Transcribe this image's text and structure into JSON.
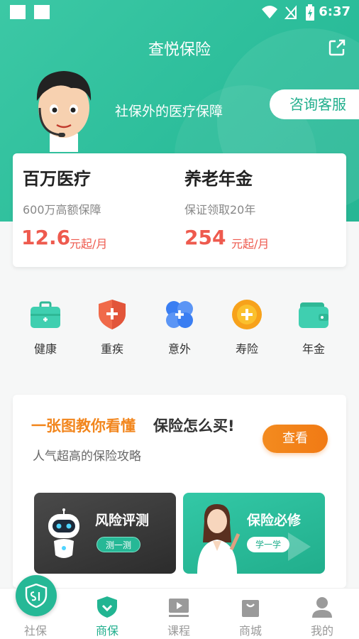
{
  "status_bar": {
    "time": "6:37"
  },
  "header": {
    "title": "查悦保险",
    "slogan": "社保外的医疗保障",
    "service_button": "咨询客服"
  },
  "products": [
    {
      "name": "百万医疗",
      "subtitle": "600万高额保障",
      "price": "12.6",
      "unit": "元起/月"
    },
    {
      "name": "养老年金",
      "subtitle": "保证领取20年",
      "price": "254",
      "unit": "元起/月"
    }
  ],
  "categories": [
    {
      "label": "健康",
      "icon": "medical-kit-icon",
      "color": "#3fcfb0"
    },
    {
      "label": "重疾",
      "icon": "shield-plus-icon",
      "color": "#f06a4a"
    },
    {
      "label": "意外",
      "icon": "cross-flower-icon",
      "color": "#3a7ef2"
    },
    {
      "label": "寿险",
      "icon": "sun-plus-icon",
      "color": "#f7a21b"
    },
    {
      "label": "年金",
      "icon": "wallet-icon",
      "color": "#3fcfb0"
    }
  ],
  "guide": {
    "title_highlight": "一张图教你看懂",
    "title_rest": "保险怎么买!",
    "subtitle": "人气超高的保险攻略",
    "button": "查看",
    "tiles": [
      {
        "title": "风险评测",
        "button": "测一测"
      },
      {
        "title": "保险必修",
        "button": "学一学"
      }
    ]
  },
  "tabbar": {
    "active": "商保",
    "items": [
      {
        "label": "社保",
        "icon": "social-security-icon"
      },
      {
        "label": "商保",
        "icon": "shield-check-icon"
      },
      {
        "label": "课程",
        "icon": "video-play-icon"
      },
      {
        "label": "商城",
        "icon": "shopping-bag-icon"
      },
      {
        "label": "我的",
        "icon": "person-icon"
      }
    ]
  },
  "colors": {
    "brand": "#2bbd9a",
    "price": "#ee5a4e",
    "accent_orange": "#f2861d"
  }
}
